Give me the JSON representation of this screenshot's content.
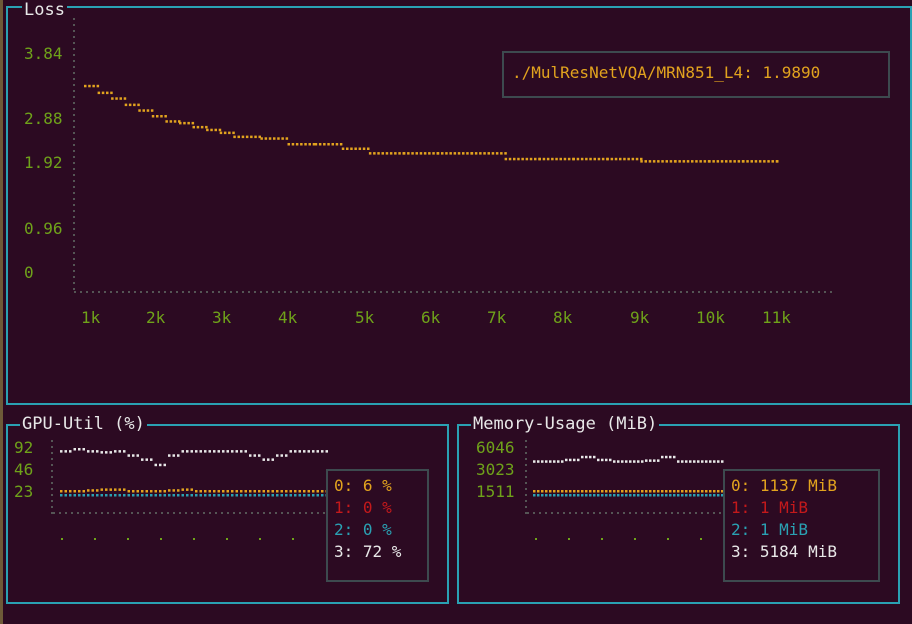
{
  "colors": {
    "background": "#2c0a22",
    "border": "#2aa1b3",
    "tick_label": "#6fa21a",
    "axis_dots": "#555555",
    "series_loss": "#e2a31e",
    "gpu0": "#e2a31e",
    "gpu1": "#c4191b",
    "gpu2": "#2aa1b3",
    "gpu3": "#e8e8e8"
  },
  "loss": {
    "title": "Loss",
    "legend": "./MulResNetVQA/MRN851_L4: 1.9890"
  },
  "gpu": {
    "title": "GPU-Util (%)",
    "legend": [
      "0: 6 %",
      "1: 0 %",
      "2: 0 %",
      "3: 72 %"
    ]
  },
  "memory": {
    "title": "Memory-Usage (MiB)",
    "legend": [
      "0: 1137 MiB",
      "1: 1 MiB",
      "2: 1 MiB",
      "3: 5184 MiB"
    ]
  },
  "chart_data": [
    {
      "type": "line",
      "title": "Loss",
      "y_ticks": [
        "3.84",
        "2.88",
        "1.92",
        "0.96",
        "0"
      ],
      "x_ticks": [
        "1k",
        "2k",
        "3k",
        "4k",
        "5k",
        "6k",
        "7k",
        "8k",
        "9k",
        "10k",
        "11k"
      ],
      "ylim": [
        0,
        4.3
      ],
      "xlim": [
        700,
        12500
      ],
      "series": [
        {
          "name": "./MulResNetVQA/MRN851_L4",
          "x": [
            800,
            1000,
            1200,
            1400,
            1600,
            1800,
            2000,
            2200,
            2400,
            2600,
            2800,
            3000,
            3400,
            3800,
            4200,
            4600,
            5000,
            5500,
            6000,
            6500,
            7000,
            7500,
            8000,
            8500,
            9000,
            9500,
            10000,
            10500,
            11000
          ],
          "y": [
            3.3,
            3.18,
            3.08,
            2.97,
            2.87,
            2.77,
            2.68,
            2.65,
            2.58,
            2.53,
            2.48,
            2.41,
            2.38,
            2.28,
            2.28,
            2.2,
            2.12,
            2.12,
            2.12,
            2.12,
            2.02,
            2.02,
            2.02,
            2.02,
            1.98,
            1.98,
            1.98,
            1.98,
            1.98
          ]
        }
      ]
    },
    {
      "type": "line",
      "title": "GPU-Util (%)",
      "y_ticks": [
        "92",
        "46",
        "23"
      ],
      "series": [
        {
          "name": "0",
          "values": [
            6,
            6,
            7,
            8,
            8,
            6,
            6,
            6,
            7,
            8,
            6,
            6,
            6,
            6,
            6,
            6,
            6,
            6,
            6,
            6
          ]
        },
        {
          "name": "1",
          "values": [
            0,
            0,
            0,
            0,
            0,
            0,
            0,
            0,
            0,
            0,
            0,
            0,
            0,
            0,
            0,
            0,
            0,
            0,
            0,
            0
          ]
        },
        {
          "name": "2",
          "values": [
            0,
            0,
            0,
            0,
            0,
            0,
            0,
            0,
            0,
            0,
            0,
            0,
            0,
            0,
            0,
            0,
            0,
            0,
            0,
            0
          ]
        },
        {
          "name": "3",
          "values": [
            88,
            92,
            88,
            86,
            88,
            80,
            72,
            62,
            80,
            88,
            88,
            88,
            88,
            88,
            80,
            72,
            80,
            88,
            88,
            88
          ]
        }
      ]
    },
    {
      "type": "line",
      "title": "Memory-Usage (MiB)",
      "y_ticks": [
        "6046",
        "3023",
        "1511"
      ],
      "series": [
        {
          "name": "0",
          "values": [
            1137,
            1137,
            1137,
            1137,
            1137,
            1137,
            1137,
            1137,
            1137,
            1137,
            1137,
            1137
          ]
        },
        {
          "name": "1",
          "values": [
            1,
            1,
            1,
            1,
            1,
            1,
            1,
            1,
            1,
            1,
            1,
            1
          ]
        },
        {
          "name": "2",
          "values": [
            1,
            1,
            1,
            1,
            1,
            1,
            1,
            1,
            1,
            1,
            1,
            1
          ]
        },
        {
          "name": "3",
          "values": [
            5184,
            5184,
            5400,
            5800,
            5400,
            5184,
            5184,
            5300,
            5800,
            5184,
            5184,
            5184
          ]
        }
      ]
    }
  ]
}
